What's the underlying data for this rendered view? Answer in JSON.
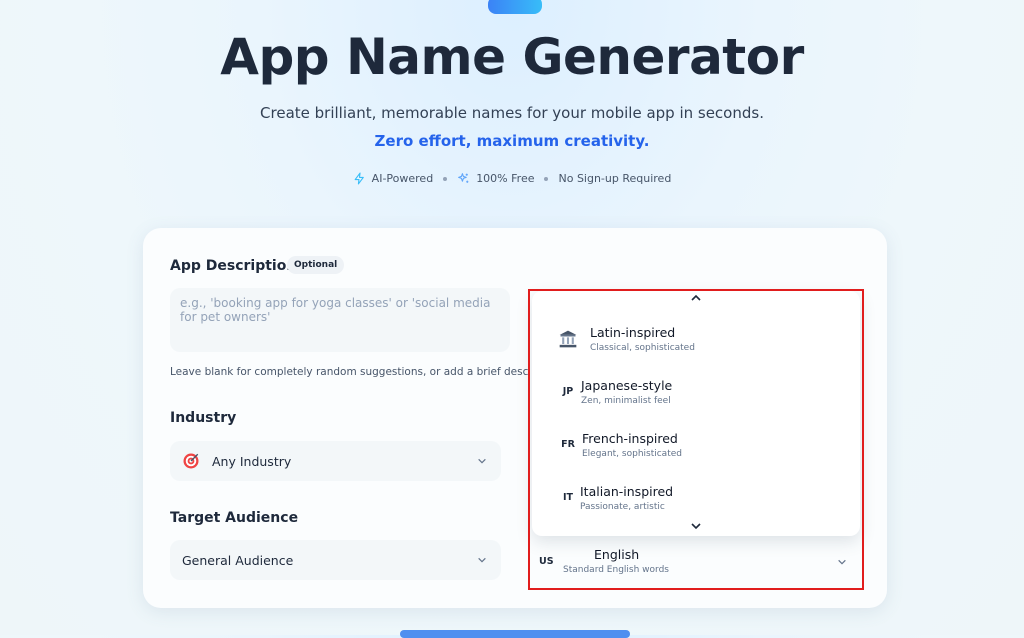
{
  "header": {
    "title": "App Name Generator",
    "subtitle_main": "Create brilliant, memorable names for your mobile app in seconds.",
    "subtitle_accent": "Zero effort, maximum creativity."
  },
  "features": [
    {
      "label": "AI-Powered",
      "icon": "lightning-icon"
    },
    {
      "label": "100% Free",
      "icon": "sparkle-icon"
    },
    {
      "label": "No Sign-up Required",
      "icon": ""
    }
  ],
  "form": {
    "description": {
      "label": "App Description",
      "badge": "Optional",
      "placeholder": "e.g., 'booking app for yoga classes' or 'social media for pet owners'",
      "value": "",
      "hint": "Leave blank for completely random suggestions, or add a brief description"
    },
    "industry": {
      "label": "Industry",
      "value": "Any Industry",
      "icon": "target-icon"
    },
    "audience": {
      "label": "Target Audience",
      "value": "General Audience"
    },
    "language": {
      "selected": {
        "code": "US",
        "name": "English",
        "desc": "Standard English words"
      },
      "options": [
        {
          "code": "",
          "icon": "classical-building-icon",
          "name": "Latin-inspired",
          "desc": "Classical, sophisticated"
        },
        {
          "code": "JP",
          "name": "Japanese-style",
          "desc": "Zen, minimalist feel"
        },
        {
          "code": "FR",
          "name": "French-inspired",
          "desc": "Elegant, sophisticated"
        },
        {
          "code": "IT",
          "name": "Italian-inspired",
          "desc": "Passionate, artistic"
        }
      ]
    }
  },
  "colors": {
    "accent": "#2563eb",
    "highlight": "#e11d1d",
    "title": "#1e293b"
  }
}
